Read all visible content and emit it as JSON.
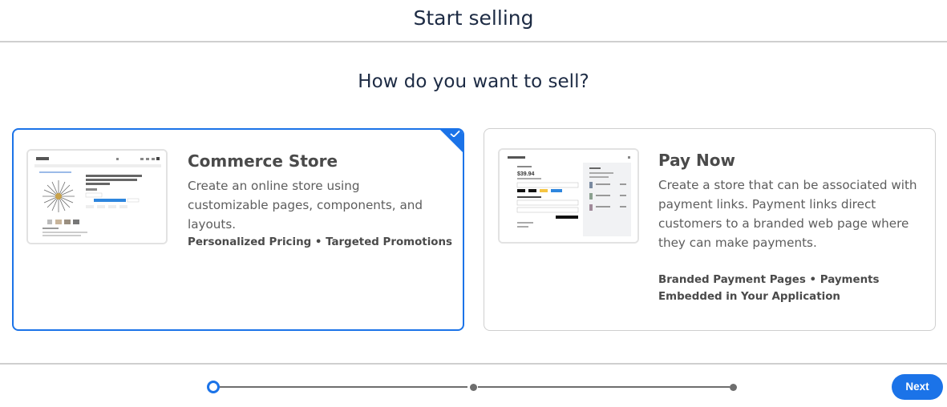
{
  "header": {
    "title": "Start selling"
  },
  "question": "How do you want to sell?",
  "options": [
    {
      "title": "Commerce Store",
      "description": "Create an online store using customizable pages, components, and layouts.",
      "features": "Personalized Pricing • Targeted Promotions",
      "selected": true
    },
    {
      "title": "Pay Now",
      "description": "Create a store that can be associated with payment links. Payment links direct customers to a branded web page where they can make payments.",
      "features": "Branded Payment Pages • Payments Embedded in Your Application",
      "selected": false
    }
  ],
  "thumb_paynow": {
    "price": "$39.94"
  },
  "stepper": {
    "total_steps": 3,
    "current_step": 1
  },
  "footer": {
    "next_label": "Next"
  },
  "colors": {
    "accent": "#1b73e8",
    "border": "#cfcfcf",
    "text": "#1d2b44"
  }
}
